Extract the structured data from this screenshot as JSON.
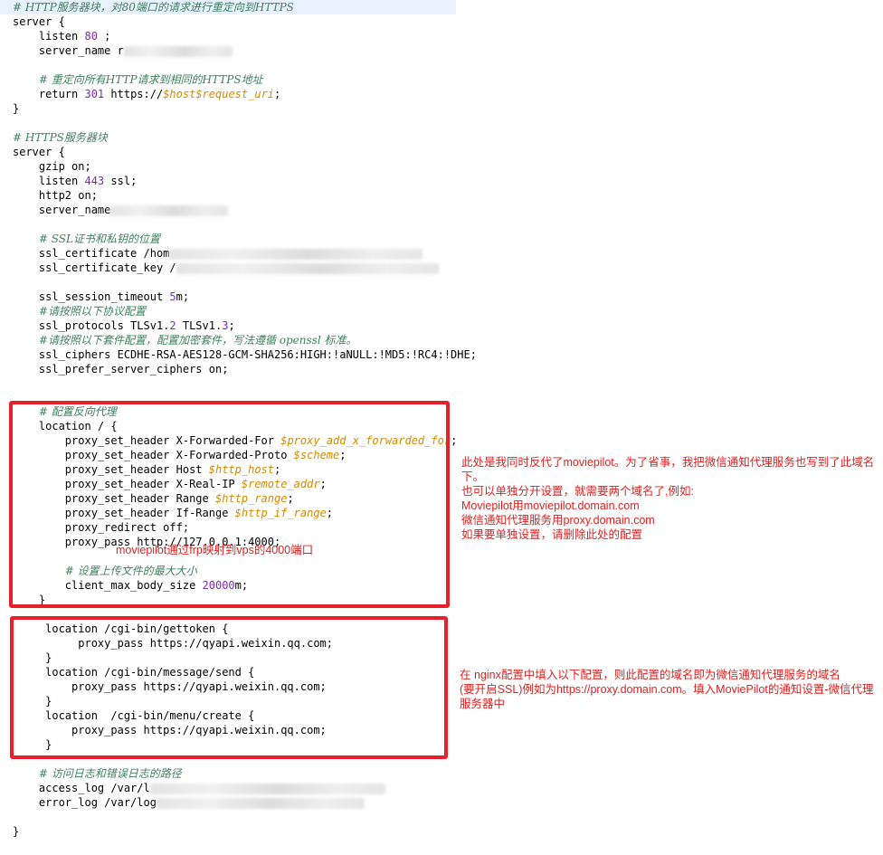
{
  "code_lines": [
    {
      "t": 0,
      "segs": [
        [
          "comment",
          "# HTTP服务器块，对80端口的请求进行重定向到HTTPS"
        ]
      ],
      "hl": true
    },
    {
      "t": 16,
      "segs": [
        [
          "text",
          "server {"
        ]
      ]
    },
    {
      "t": 32,
      "segs": [
        [
          "text",
          "    listen "
        ],
        [
          "num",
          "80"
        ],
        [
          "text",
          " ;"
        ]
      ]
    },
    {
      "t": 48,
      "segs": [
        [
          "text",
          "    server_name r"
        ],
        [
          "blur",
          "120"
        ]
      ]
    },
    {
      "t": 80,
      "segs": [
        [
          "text",
          "    "
        ],
        [
          "comment",
          "# 重定向所有HTTP请求到相同的HTTPS地址"
        ]
      ]
    },
    {
      "t": 96,
      "segs": [
        [
          "text",
          "    return "
        ],
        [
          "num",
          "301"
        ],
        [
          "text",
          " https://"
        ],
        [
          "var",
          "$host$request_uri"
        ],
        [
          "text",
          ";"
        ]
      ]
    },
    {
      "t": 112,
      "segs": [
        [
          "text",
          "}"
        ]
      ]
    },
    {
      "t": 144,
      "segs": [
        [
          "comment",
          "# HTTPS服务器块"
        ]
      ]
    },
    {
      "t": 160,
      "segs": [
        [
          "text",
          "server {"
        ]
      ]
    },
    {
      "t": 176,
      "segs": [
        [
          "text",
          "    gzip on;"
        ]
      ]
    },
    {
      "t": 192,
      "segs": [
        [
          "text",
          "    listen "
        ],
        [
          "num",
          "443"
        ],
        [
          "text",
          " ssl;"
        ]
      ]
    },
    {
      "t": 208,
      "segs": [
        [
          "text",
          "    http2 on;"
        ]
      ]
    },
    {
      "t": 224,
      "segs": [
        [
          "text",
          "    server_name"
        ],
        [
          "blur",
          "130"
        ]
      ]
    },
    {
      "t": 256,
      "segs": [
        [
          "text",
          "    "
        ],
        [
          "comment",
          "# SSL证书和私钥的位置"
        ]
      ]
    },
    {
      "t": 272,
      "segs": [
        [
          "text",
          "    ssl_certificate /hom"
        ],
        [
          "blur",
          "280"
        ]
      ]
    },
    {
      "t": 288,
      "segs": [
        [
          "text",
          "    ssl_certificate_key /"
        ],
        [
          "blur",
          "290"
        ]
      ]
    },
    {
      "t": 320,
      "segs": [
        [
          "text",
          "    ssl_session_timeout "
        ],
        [
          "num",
          "5"
        ],
        [
          "text",
          "m;"
        ]
      ]
    },
    {
      "t": 336,
      "segs": [
        [
          "text",
          "    "
        ],
        [
          "comment",
          "#请按照以下协议配置"
        ]
      ]
    },
    {
      "t": 352,
      "segs": [
        [
          "text",
          "    ssl_protocols TLSv1."
        ],
        [
          "num",
          "2"
        ],
        [
          "text",
          " TLSv1."
        ],
        [
          "num",
          "3"
        ],
        [
          "text",
          ";"
        ]
      ]
    },
    {
      "t": 368,
      "segs": [
        [
          "text",
          "    "
        ],
        [
          "comment",
          "#请按照以下套件配置，配置加密套件，写法遵循 openssl 标准。"
        ]
      ]
    },
    {
      "t": 384,
      "segs": [
        [
          "text",
          "    ssl_ciphers ECDHE-RSA-AES128-GCM-SHA256:HIGH:!aNULL:!MD5:!RC4:!DHE;"
        ]
      ]
    },
    {
      "t": 400,
      "segs": [
        [
          "text",
          "    ssl_prefer_server_ciphers on;"
        ]
      ]
    },
    {
      "t": 447,
      "segs": [
        [
          "text",
          "    "
        ],
        [
          "comment",
          "# 配置反向代理"
        ]
      ]
    },
    {
      "t": 463,
      "segs": [
        [
          "text",
          "    location / {"
        ]
      ]
    },
    {
      "t": 479,
      "segs": [
        [
          "text",
          "        proxy_set_header X-Forwarded-For "
        ],
        [
          "var",
          "$proxy_add_x_forwarded_for"
        ],
        [
          "text",
          ";"
        ]
      ]
    },
    {
      "t": 495,
      "segs": [
        [
          "text",
          "        proxy_set_header X-Forwarded-Proto "
        ],
        [
          "var",
          "$scheme"
        ],
        [
          "text",
          ";"
        ]
      ]
    },
    {
      "t": 511,
      "segs": [
        [
          "text",
          "        proxy_set_header Host "
        ],
        [
          "var",
          "$http_host"
        ],
        [
          "text",
          ";"
        ]
      ]
    },
    {
      "t": 527,
      "segs": [
        [
          "text",
          "        proxy_set_header X-Real-IP "
        ],
        [
          "var",
          "$remote_addr"
        ],
        [
          "text",
          ";"
        ]
      ]
    },
    {
      "t": 543,
      "segs": [
        [
          "text",
          "        proxy_set_header Range "
        ],
        [
          "var",
          "$http_range"
        ],
        [
          "text",
          ";"
        ]
      ]
    },
    {
      "t": 559,
      "segs": [
        [
          "text",
          "        proxy_set_header If-Range "
        ],
        [
          "var",
          "$http_if_range"
        ],
        [
          "text",
          ";"
        ]
      ]
    },
    {
      "t": 575,
      "segs": [
        [
          "text",
          "        proxy_redirect off;"
        ]
      ]
    },
    {
      "t": 591,
      "segs": [
        [
          "text",
          "        proxy_pass http://127.0.0.1:4000;"
        ]
      ]
    },
    {
      "t": 623,
      "segs": [
        [
          "text",
          "        "
        ],
        [
          "comment",
          "# 设置上传文件的最大大小"
        ]
      ]
    },
    {
      "t": 639,
      "segs": [
        [
          "text",
          "        client_max_body_size "
        ],
        [
          "num",
          "20000"
        ],
        [
          "text",
          "m;"
        ]
      ]
    },
    {
      "t": 655,
      "segs": [
        [
          "text",
          "    }"
        ]
      ]
    },
    {
      "t": 687,
      "segs": [
        [
          "text",
          "     location /cgi-bin/gettoken {"
        ]
      ]
    },
    {
      "t": 703,
      "segs": [
        [
          "text",
          "          proxy_pass https://qyapi.weixin.qq.com;"
        ]
      ]
    },
    {
      "t": 719,
      "segs": [
        [
          "text",
          "     }"
        ]
      ]
    },
    {
      "t": 735,
      "segs": [
        [
          "text",
          "     location /cgi-bin/message/send {"
        ]
      ]
    },
    {
      "t": 751,
      "segs": [
        [
          "text",
          "         proxy_pass https://qyapi.weixin.qq.com;"
        ]
      ]
    },
    {
      "t": 767,
      "segs": [
        [
          "text",
          "     }"
        ]
      ]
    },
    {
      "t": 783,
      "segs": [
        [
          "text",
          "     location  /cgi-bin/menu/create {"
        ]
      ]
    },
    {
      "t": 799,
      "segs": [
        [
          "text",
          "         proxy_pass https://qyapi.weixin.qq.com;"
        ]
      ]
    },
    {
      "t": 815,
      "segs": [
        [
          "text",
          "     }"
        ]
      ]
    },
    {
      "t": 847,
      "segs": [
        [
          "text",
          "    "
        ],
        [
          "comment",
          "# 访问日志和错误日志的路径"
        ]
      ]
    },
    {
      "t": 863,
      "segs": [
        [
          "text",
          "    access_log /var/l"
        ],
        [
          "blur",
          "260"
        ]
      ]
    },
    {
      "t": 879,
      "segs": [
        [
          "text",
          "    error_log /var/log"
        ],
        [
          "blur",
          "230"
        ]
      ]
    },
    {
      "t": 911,
      "segs": [
        [
          "text",
          "}"
        ]
      ]
    }
  ],
  "annotations": {
    "inline_note": "moviepilot通过frp映射到vps的4000端口",
    "proxy_note": [
      "此处是我同时反代了moviepilot。为了省事，我把微信通知代理服务也写到了此域名",
      "下。",
      "也可以单独分开设置，就需要两个域名了,例如:",
      "Moviepilot用moviepilot.domain.com",
      "微信通知代理服务用proxy.domain.com",
      "如果要单独设置，请删除此处的配置"
    ],
    "wechat_note": [
      "在 nginx配置中填入以下配置，则此配置的域名即为微信通知代理服务的域名",
      "(要开启SSL)例如为https://proxy.domain.com。填入MoviePilot的通知设置-微信代理",
      "服务器中"
    ]
  },
  "colors": {
    "comment": "#3f7f5f",
    "number": "#7b2bb2",
    "variable": "#d18b00",
    "annotation": "#e02020",
    "highlight_line": "#e8f2fe"
  }
}
